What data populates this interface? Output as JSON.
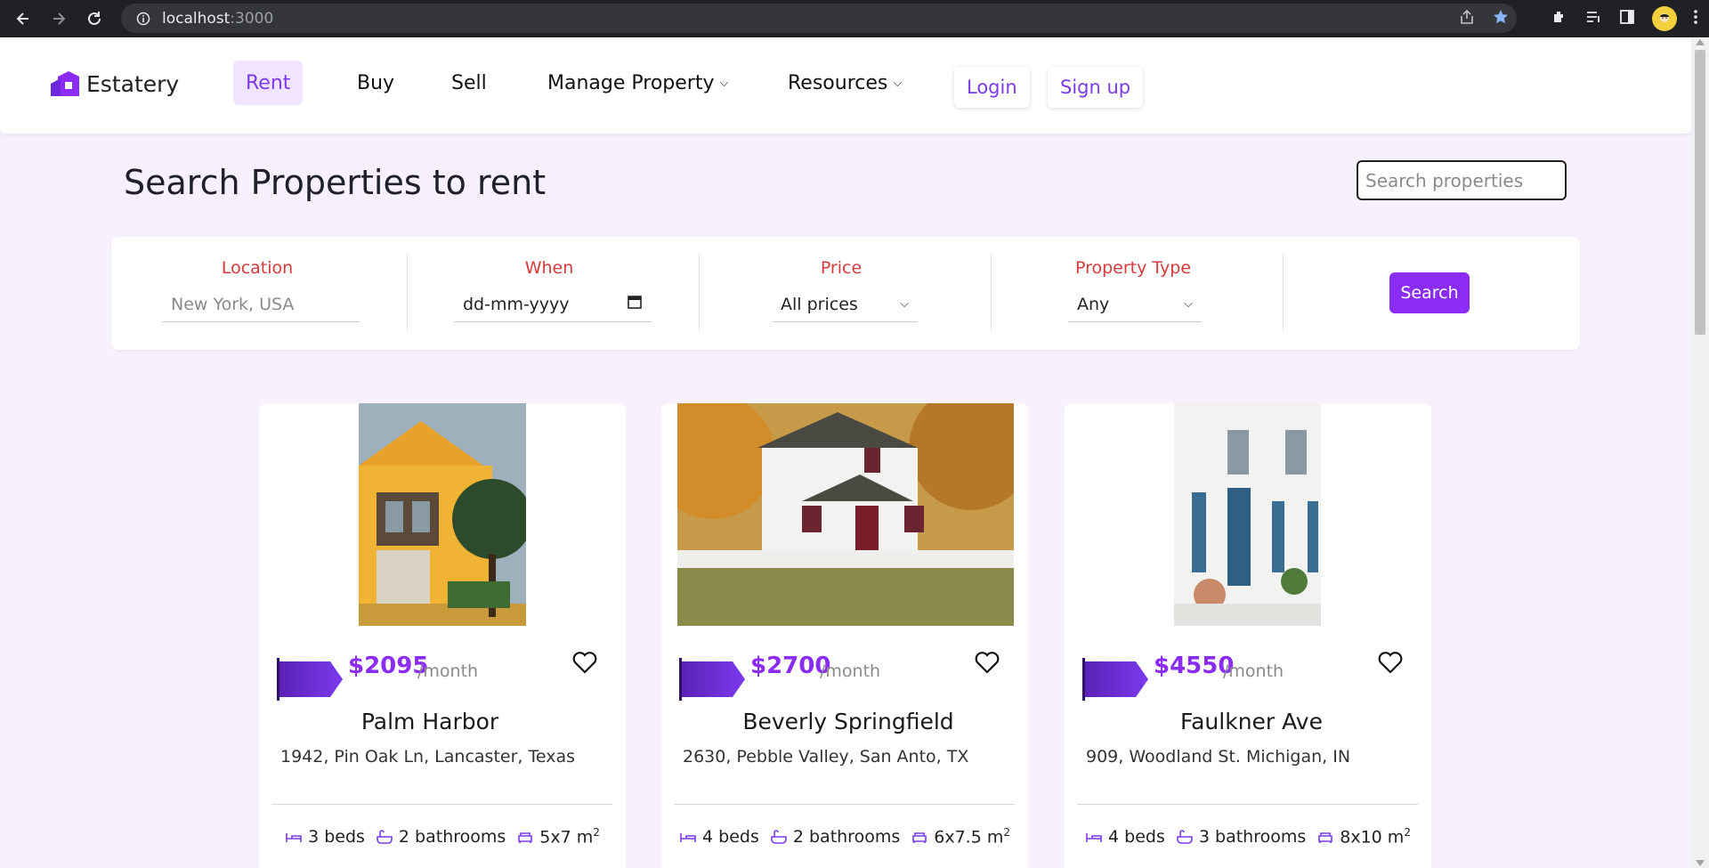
{
  "browser": {
    "url_host": "localhost",
    "url_port": ":3000"
  },
  "brand": {
    "name": "Estatery",
    "accent": "#7c3aed",
    "button": "#8b2cf5",
    "label_color": "#d63a3a"
  },
  "nav": {
    "rent": "Rent",
    "buy": "Buy",
    "sell": "Sell",
    "manage": "Manage Property",
    "resources": "Resources",
    "login": "Login",
    "signup": "Sign up"
  },
  "page": {
    "title": "Search Properties to rent",
    "search_placeholder": "Search properties"
  },
  "filters": {
    "location_label": "Location",
    "location_placeholder": "New York, USA",
    "when_label": "When",
    "when_value": "dd-mm-yyyy",
    "price_label": "Price",
    "price_value": "All prices",
    "type_label": "Property Type",
    "type_value": "Any",
    "search_button": "Search"
  },
  "listings": [
    {
      "price": "$2095",
      "per": "/month",
      "name": "Palm Harbor",
      "address": "1942, Pin Oak Ln, Lancaster, Texas",
      "beds": "3 beds",
      "baths": "2 bathrooms",
      "area": "5x7 m",
      "area_sup": "2"
    },
    {
      "price": "$2700",
      "per": "/month",
      "name": "Beverly Springfield",
      "address": "2630, Pebble Valley, San Anto, TX",
      "beds": "4 beds",
      "baths": "2 bathrooms",
      "area": "6x7.5 m",
      "area_sup": "2"
    },
    {
      "price": "$4550",
      "per": "/month",
      "name": "Faulkner Ave",
      "address": "909, Woodland St. Michigan, IN",
      "beds": "4 beds",
      "baths": "3 bathrooms",
      "area": "8x10 m",
      "area_sup": "2"
    }
  ]
}
